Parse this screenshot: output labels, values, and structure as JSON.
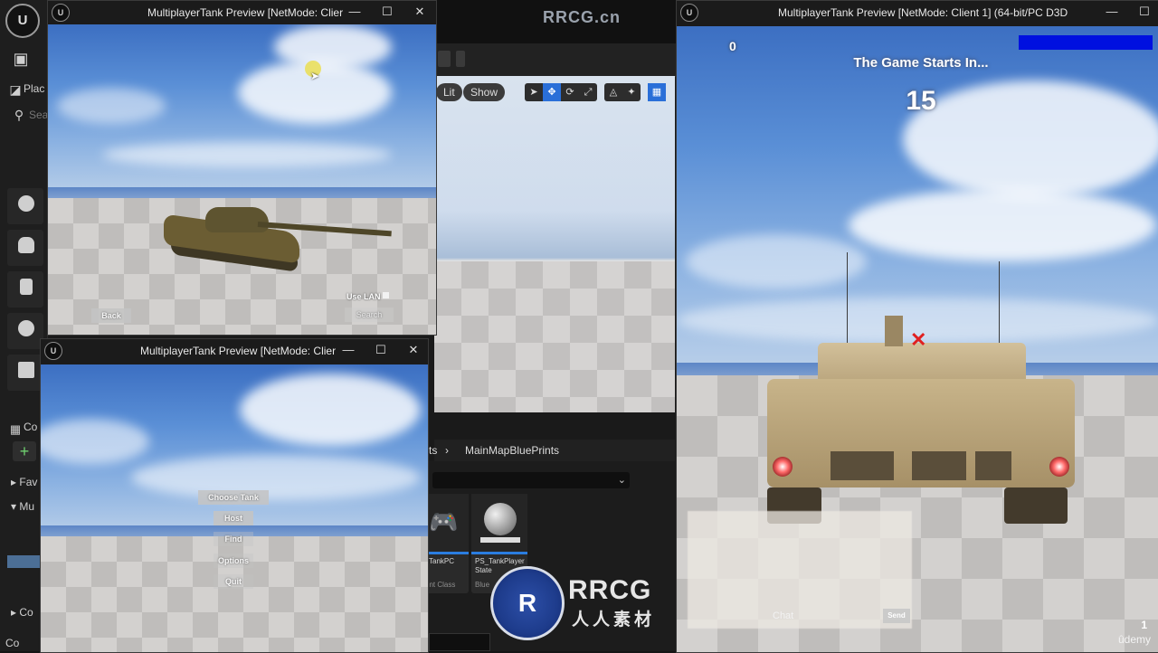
{
  "editor": {
    "logo_letter": "U",
    "left_labels": [
      "Plac",
      "Sea",
      "Co",
      "Fav",
      "Mu",
      "Co",
      "Co"
    ],
    "viewport_buttons": [
      "Lit",
      "Show"
    ],
    "breadcrumb_prefix": "ts",
    "breadcrumb": "MainMapBluePrints",
    "assets": [
      {
        "name": "TankPC",
        "type": "rint Class"
      },
      {
        "name": "PS_TankPlayer State",
        "type": "Blue"
      }
    ]
  },
  "watermark_top": "RRCG.cn",
  "window1": {
    "title": "MultiplayerTank Preview [NetMode: Clier",
    "back_label": "Back",
    "use_lan_label": "Use LAN",
    "search_label": "Search"
  },
  "window2": {
    "title": "MultiplayerTank Preview [NetMode: Clier",
    "menu": [
      "Choose Tank",
      "Host",
      "Find",
      "Options",
      "Quit"
    ]
  },
  "window3": {
    "title": "MultiplayerTank Preview [NetMode: Client 1]  (64-bit/PC D3D",
    "score": "0",
    "game_starts_text": "The Game Starts In...",
    "countdown": "15",
    "health_color": "#0010e0",
    "chat_placeholder": "Chat",
    "send_label": "Send"
  },
  "window_controls": {
    "minimize": "—",
    "maximize": "☐",
    "close": "✕"
  },
  "logo": {
    "mark": "R",
    "text": "RRCG",
    "subtext": "人人素材"
  },
  "udemy_label": "ûdemy",
  "corner_number": "1"
}
